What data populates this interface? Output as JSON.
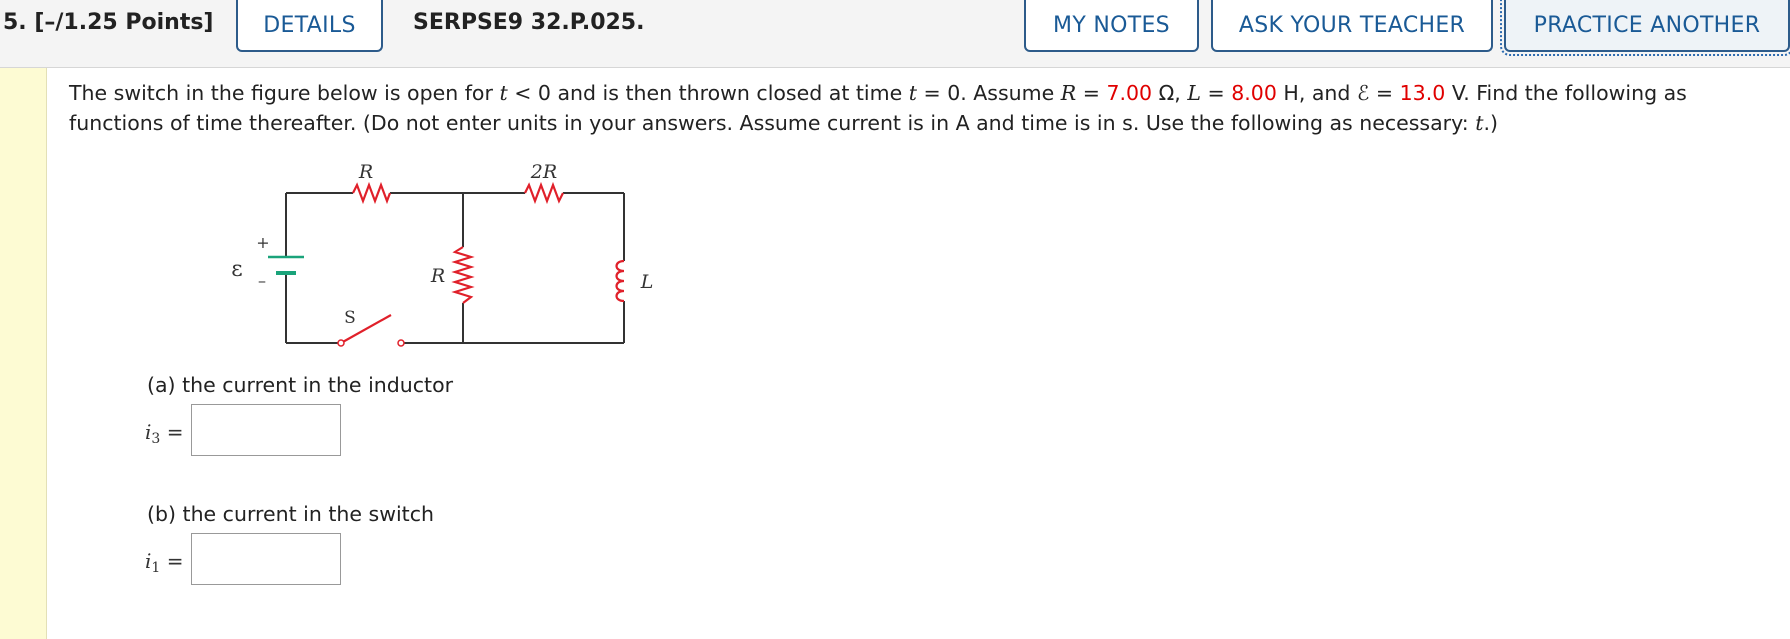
{
  "header": {
    "question_number": "5.",
    "points": "[–/1.25 Points]",
    "details_label": "DETAILS",
    "problem_code": "SERPSE9 32.P.025.",
    "my_notes_label": "MY NOTES",
    "ask_teacher_label": "ASK YOUR TEACHER",
    "practice_another_label": "PRACTICE ANOTHER"
  },
  "question": {
    "t1": "The switch in the figure below is open for",
    "t_var": "t",
    "t2": "< 0  and is then thrown closed at time",
    "t3": "= 0.  Assume",
    "R_var": "R",
    "eq": "=",
    "R_value": "7.00",
    "R_unit": "Ω,",
    "L_var": "L",
    "L_value": "8.00",
    "L_unit": "H,  and",
    "emf_symbol": "ℰ",
    "emf_value": "13.0",
    "emf_unit": "V.  Find the following as functions of time thereafter. (Do not enter units in your answers. Assume current is in A and time is in s. Use the following as necessary:",
    "t_end": "t",
    "close": ".)"
  },
  "figure": {
    "label_R_top": "R",
    "label_2R": "2R",
    "label_R_mid": "R",
    "label_L": "L",
    "label_emf": "ε",
    "label_plus": "+",
    "label_minus": "–",
    "label_switch": "S"
  },
  "parts": {
    "a_label": "(a) the current in the inductor",
    "a_var": "i",
    "a_sub": "3",
    "a_eq": "=",
    "a_value": "",
    "b_label": "(b) the current in the switch",
    "b_var": "i",
    "b_sub": "1",
    "b_eq": "=",
    "b_value": ""
  },
  "colors": {
    "link_blue": "#1a5a96",
    "given_red": "#e00000",
    "sidebar_yellow": "#fdfbd3",
    "battery_green": "#1aa37a",
    "resistor_red": "#e0202a"
  }
}
